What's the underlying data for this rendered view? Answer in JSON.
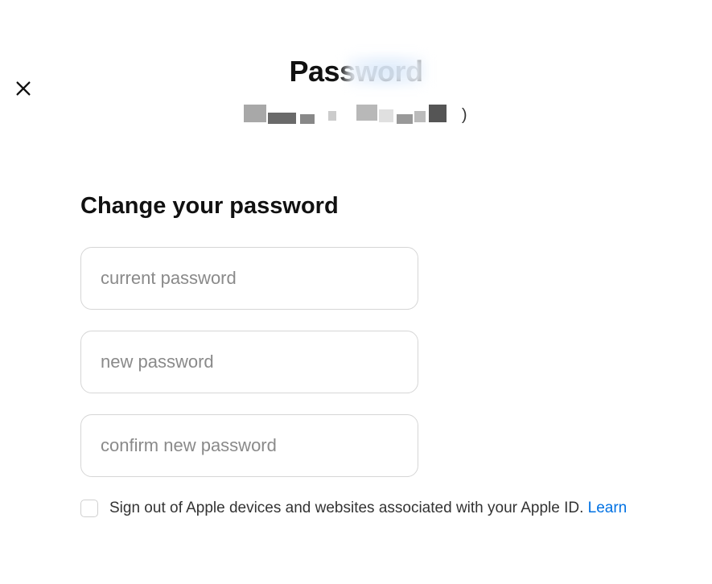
{
  "header": {
    "title": "Password",
    "subtitle_trailing": ")"
  },
  "form": {
    "heading": "Change your password",
    "current_placeholder": "current password",
    "new_placeholder": "new password",
    "confirm_placeholder": "confirm new password",
    "signout_label": "Sign out of Apple devices and websites associated with your Apple ID. ",
    "learn_more": "Learn"
  }
}
